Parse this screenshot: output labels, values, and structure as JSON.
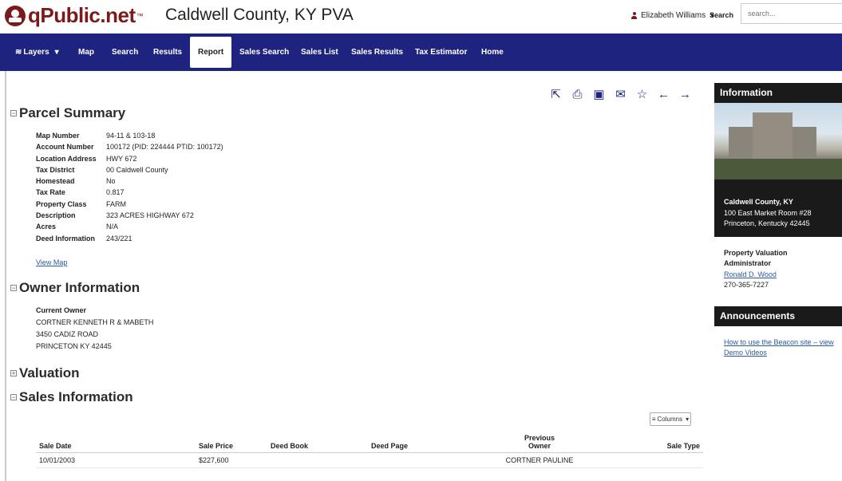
{
  "header": {
    "logo_text": "qPublic.net",
    "logo_tm": "™",
    "title": "Caldwell County, KY PVA",
    "user_name": "Elizabeth Williams",
    "search_label": "Search",
    "search_placeholder": "search..."
  },
  "nav": {
    "items": [
      "Layers",
      "Map",
      "Search",
      "Results",
      "Report",
      "Sales Search",
      "Sales List",
      "Sales Results",
      "Tax Estimator",
      "Home"
    ],
    "active": "Report"
  },
  "toolbar": {
    "icons": [
      "share-icon",
      "print-icon",
      "image-icon",
      "email-icon",
      "star-icon",
      "arrow-left-icon",
      "arrow-right-icon"
    ]
  },
  "parcel_summary": {
    "title": "Parcel Summary",
    "rows": [
      {
        "label": "Map Number",
        "value": "94-11 & 103-18"
      },
      {
        "label": "Account Number",
        "value": "100172 (PID: 224444 PTID: 100172)"
      },
      {
        "label": "Location Address",
        "value": "HWY 672"
      },
      {
        "label": "Tax District",
        "value": "00 Caldwell County"
      },
      {
        "label": "Homestead",
        "value": "No"
      },
      {
        "label": "Tax Rate",
        "value": "0.817"
      },
      {
        "label": "Property Class",
        "value": "FARM"
      },
      {
        "label": "Description",
        "value": "323 ACRES HIGHWAY 672"
      },
      {
        "label": "Acres",
        "value": "N/A"
      },
      {
        "label": "Deed Information",
        "value": "243/221"
      }
    ],
    "view_map": "View Map"
  },
  "owner": {
    "title": "Owner Information",
    "label": "Current Owner",
    "lines": [
      "CORTNER KENNETH R & MABETH",
      "3450 CADIZ ROAD",
      "PRINCETON KY 42445"
    ]
  },
  "valuation": {
    "title": "Valuation"
  },
  "sales": {
    "title": "Sales Information",
    "columns_button": "Columns",
    "headers": [
      "Sale Date",
      "Sale Price",
      "Deed Book",
      "Deed Page",
      "Previous Owner",
      "Sale Type"
    ],
    "rows": [
      [
        "10/01/2003",
        "$227,600",
        "",
        "",
        "CORTNER PAULINE",
        ""
      ]
    ]
  },
  "sidebar": {
    "info_title": "Information",
    "address_lines": [
      "Caldwell County, KY",
      "100 East Market Room #28",
      "Princeton, Kentucky 42445"
    ],
    "pva_title_1": "Property Valuation",
    "pva_title_2": "Administrator",
    "pva_name": "Ronald D. Wood",
    "pva_phone": "270-365-7227",
    "announcements_title": "Announcements",
    "announcement_link": "How to use the Beacon site – view Demo Videos"
  }
}
